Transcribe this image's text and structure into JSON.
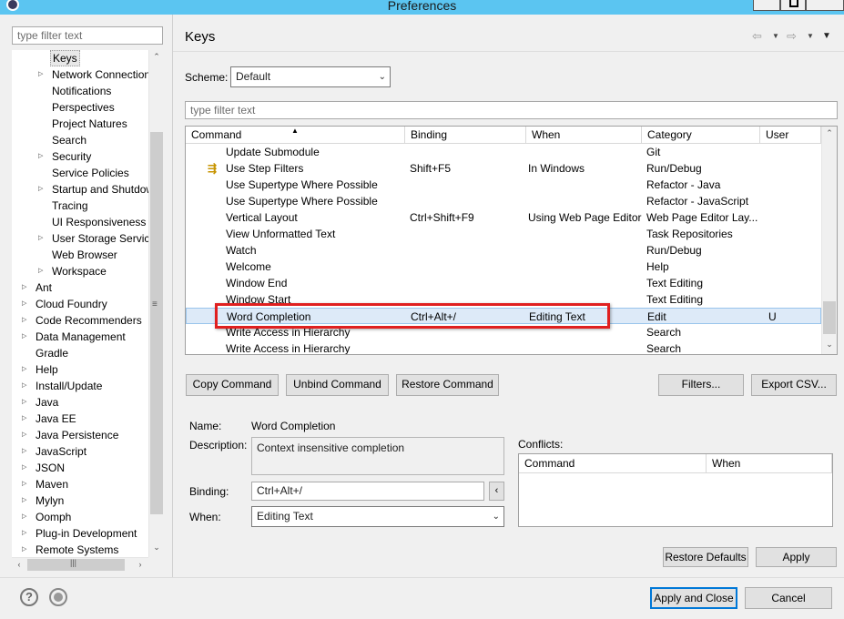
{
  "window": {
    "title": "Preferences"
  },
  "left": {
    "filter_placeholder": "type filter text",
    "tree": [
      {
        "label": "Keys",
        "indent": 2,
        "selected": true
      },
      {
        "label": "Network Connections",
        "indent": 2,
        "expander": true
      },
      {
        "label": "Notifications",
        "indent": 2
      },
      {
        "label": "Perspectives",
        "indent": 2
      },
      {
        "label": "Project Natures",
        "indent": 2
      },
      {
        "label": "Search",
        "indent": 2
      },
      {
        "label": "Security",
        "indent": 2,
        "expander": true
      },
      {
        "label": "Service Policies",
        "indent": 2
      },
      {
        "label": "Startup and Shutdown",
        "indent": 2,
        "expander": true
      },
      {
        "label": "Tracing",
        "indent": 2
      },
      {
        "label": "UI Responsiveness Monitoring",
        "indent": 2
      },
      {
        "label": "User Storage Service",
        "indent": 2,
        "expander": true
      },
      {
        "label": "Web Browser",
        "indent": 2
      },
      {
        "label": "Workspace",
        "indent": 2,
        "expander": true
      },
      {
        "label": "Ant",
        "indent": 1,
        "expander": true
      },
      {
        "label": "Cloud Foundry",
        "indent": 1,
        "expander": true
      },
      {
        "label": "Code Recommenders",
        "indent": 1,
        "expander": true
      },
      {
        "label": "Data Management",
        "indent": 1,
        "expander": true
      },
      {
        "label": "Gradle",
        "indent": 1
      },
      {
        "label": "Help",
        "indent": 1,
        "expander": true
      },
      {
        "label": "Install/Update",
        "indent": 1,
        "expander": true
      },
      {
        "label": "Java",
        "indent": 1,
        "expander": true
      },
      {
        "label": "Java EE",
        "indent": 1,
        "expander": true
      },
      {
        "label": "Java Persistence",
        "indent": 1,
        "expander": true
      },
      {
        "label": "JavaScript",
        "indent": 1,
        "expander": true
      },
      {
        "label": "JSON",
        "indent": 1,
        "expander": true
      },
      {
        "label": "Maven",
        "indent": 1,
        "expander": true
      },
      {
        "label": "Mylyn",
        "indent": 1,
        "expander": true
      },
      {
        "label": "Oomph",
        "indent": 1,
        "expander": true
      },
      {
        "label": "Plug-in Development",
        "indent": 1,
        "expander": true
      },
      {
        "label": "Remote Systems",
        "indent": 1,
        "expander": true
      }
    ]
  },
  "page": {
    "title": "Keys"
  },
  "scheme": {
    "label": "Scheme:",
    "value": "Default"
  },
  "filter": {
    "placeholder": "type filter text"
  },
  "table": {
    "columns": [
      "Command",
      "Binding",
      "When",
      "Category",
      "User"
    ],
    "rows": [
      {
        "command": "Update Submodule",
        "binding": "",
        "when": "",
        "category": "Git",
        "user": ""
      },
      {
        "command": "Use Step Filters",
        "binding": "Shift+F5",
        "when": "In Windows",
        "category": "Run/Debug",
        "user": "",
        "icon": true
      },
      {
        "command": "Use Supertype Where Possible",
        "binding": "",
        "when": "",
        "category": "Refactor - Java",
        "user": ""
      },
      {
        "command": "Use Supertype Where Possible",
        "binding": "",
        "when": "",
        "category": "Refactor - JavaScript",
        "user": ""
      },
      {
        "command": "Vertical Layout",
        "binding": "Ctrl+Shift+F9",
        "when": "Using Web Page Editor",
        "category": "Web Page Editor Lay...",
        "user": ""
      },
      {
        "command": "View Unformatted Text",
        "binding": "",
        "when": "",
        "category": "Task Repositories",
        "user": ""
      },
      {
        "command": "Watch",
        "binding": "",
        "when": "",
        "category": "Run/Debug",
        "user": ""
      },
      {
        "command": "Welcome",
        "binding": "",
        "when": "",
        "category": "Help",
        "user": ""
      },
      {
        "command": "Window End",
        "binding": "",
        "when": "",
        "category": "Text Editing",
        "user": ""
      },
      {
        "command": "Window Start",
        "binding": "",
        "when": "",
        "category": "Text Editing",
        "user": ""
      },
      {
        "command": "Word Completion",
        "binding": "Ctrl+Alt+/",
        "when": "Editing Text",
        "category": "Edit",
        "user": "U",
        "selected": true
      },
      {
        "command": "Write Access in Hierarchy",
        "binding": "",
        "when": "",
        "category": "Search",
        "user": ""
      },
      {
        "command": "Write Access in Hierarchy",
        "binding": "",
        "when": "",
        "category": "Search",
        "user": ""
      }
    ]
  },
  "buttons": {
    "copy": "Copy Command",
    "unbind": "Unbind Command",
    "restore": "Restore Command",
    "filters": "Filters...",
    "export": "Export CSV...",
    "restore_defaults": "Restore Defaults",
    "apply": "Apply",
    "apply_close": "Apply and Close",
    "cancel": "Cancel"
  },
  "details": {
    "name_label": "Name:",
    "name_value": "Word Completion",
    "description_label": "Description:",
    "description_value": "Context insensitive completion",
    "binding_label": "Binding:",
    "binding_value": "Ctrl+Alt+/",
    "when_label": "When:",
    "when_value": "Editing Text",
    "conflicts_label": "Conflicts:",
    "conflicts_columns": [
      "Command",
      "When"
    ]
  },
  "colors": {
    "titlebar": "#5bc5f1",
    "selection": "#ddeaf8",
    "highlight_box": "#e02020"
  }
}
